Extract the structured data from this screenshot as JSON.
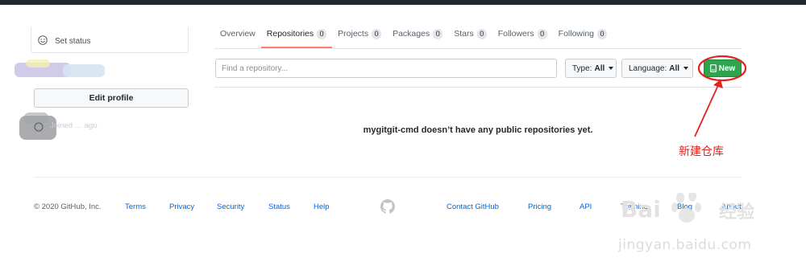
{
  "sidebar": {
    "set_status": "Set status",
    "edit_profile": "Edit profile",
    "joined_text": "Joined … ago"
  },
  "tabs": [
    {
      "label": "Overview",
      "count": null
    },
    {
      "label": "Repositories",
      "count": "0",
      "active": true
    },
    {
      "label": "Projects",
      "count": "0"
    },
    {
      "label": "Packages",
      "count": "0"
    },
    {
      "label": "Stars",
      "count": "0"
    },
    {
      "label": "Followers",
      "count": "0"
    },
    {
      "label": "Following",
      "count": "0"
    }
  ],
  "filters": {
    "search_placeholder": "Find a repository...",
    "type_label": "Type:",
    "type_value": "All",
    "language_label": "Language:",
    "language_value": "All",
    "new_button": "New"
  },
  "empty_message": "mygitgit-cmd doesn’t have any public repositories yet.",
  "footer": {
    "copyright": "© 2020 GitHub, Inc.",
    "left_links": [
      "Terms",
      "Privacy",
      "Security",
      "Status",
      "Help"
    ],
    "right_links": [
      "Contact GitHub",
      "Pricing",
      "API",
      "Training",
      "Blog",
      "About"
    ]
  },
  "annotation": {
    "label": "新建仓库",
    "color": "#e3231b"
  },
  "watermark": {
    "logo_text": "Bai",
    "cn_text": "经验",
    "url": "jingyan.baidu.com"
  },
  "colors": {
    "accent_tab": "#f9826c",
    "new_button": "#2ea44f",
    "link": "#0366d6"
  }
}
